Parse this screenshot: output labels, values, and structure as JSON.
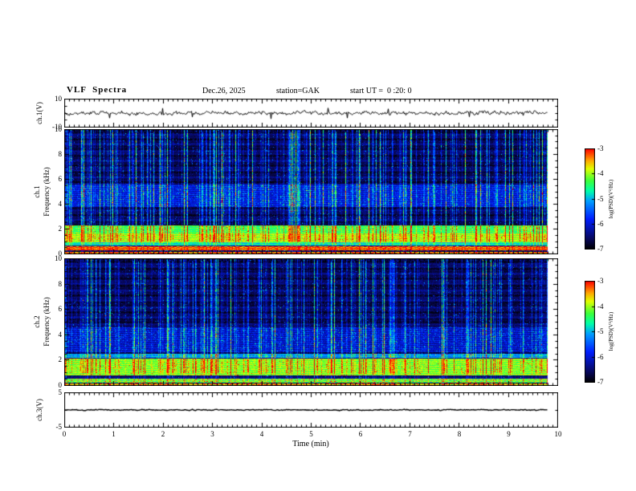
{
  "header": {
    "title": "VLF  Spectra",
    "date": "Dec.26, 2025",
    "station": "station=GAK",
    "start_ut": "start UT =  0 :20: 0"
  },
  "x_axis": {
    "label": "Time (min)",
    "min": 0,
    "max": 10,
    "major_ticks": [
      0,
      1,
      2,
      3,
      4,
      5,
      6,
      7,
      8,
      9,
      10
    ],
    "tick_labels": [
      "0",
      "1",
      "2",
      "3",
      "4",
      "5",
      "6",
      "7",
      "8",
      "9",
      "10"
    ],
    "minor_tick_interval": 0.1,
    "data_end_min": 9.8
  },
  "colorbar": {
    "label": "log(PSD)(V²/Hz)",
    "min": -7,
    "max": -3,
    "ticks": [
      -3,
      -4,
      -5,
      -6,
      -7
    ],
    "tick_labels": [
      "-3",
      "-4",
      "-5",
      "-6",
      "-7"
    ],
    "colormap": [
      [
        0.0,
        0,
        0,
        0
      ],
      [
        0.1,
        8,
        8,
        90
      ],
      [
        0.3,
        0,
        30,
        255
      ],
      [
        0.48,
        0,
        160,
        255
      ],
      [
        0.58,
        0,
        255,
        170
      ],
      [
        0.68,
        60,
        255,
        60
      ],
      [
        0.8,
        225,
        255,
        0
      ],
      [
        0.88,
        255,
        170,
        0
      ],
      [
        1.0,
        255,
        0,
        0
      ]
    ]
  },
  "chart_data": [
    {
      "type": "line",
      "name": "ch.1 voltage waveform",
      "ylabel": "ch.1(V)",
      "xlabel": "Time (min)",
      "xlim": [
        0,
        9.8
      ],
      "ylim": [
        -10,
        10
      ],
      "ytick_major": [
        10,
        -10
      ],
      "ytick_labels": [
        "10",
        "-10"
      ],
      "ytick_minor": [
        5,
        0,
        -5
      ],
      "mean_v": 0,
      "noise_amplitude_v": 1.5,
      "spike_amplitude_v": 5,
      "spike_probability": 0.012,
      "description": "Noisy broadband voltage trace centred on 0 V with sporadic impulsive spikes up to about ±5 V"
    },
    {
      "type": "heatmap",
      "name": "ch.1 VLF spectrogram",
      "ylabel_channel": "ch.1",
      "ylabel_axis": "Frequency (kHz)",
      "xlabel": "Time (min)",
      "xlim": [
        0,
        9.8
      ],
      "ylim": [
        0,
        10
      ],
      "ytick_major": [
        10,
        8,
        6,
        4,
        2,
        0
      ],
      "ytick_labels": [
        "10",
        "8",
        "6",
        "4",
        "2",
        "0"
      ],
      "value_range": [
        -7,
        -3
      ],
      "background_level": -6.8,
      "bands": [
        {
          "f_low": 0.05,
          "f_high": 0.18,
          "level": -3.4,
          "note": "thin red-orange dotted line near 0.1 kHz"
        },
        {
          "f_low": 0.3,
          "f_high": 0.6,
          "level": -3.3,
          "note": "bright red-yellow band ~0.5 kHz"
        },
        {
          "f_low": 0.65,
          "f_high": 0.95,
          "level": -4.8,
          "note": "cyan-green band"
        },
        {
          "f_low": 0.95,
          "f_high": 1.65,
          "level": -4.0,
          "note": "green-yellow band"
        },
        {
          "f_low": 1.65,
          "f_high": 2.3,
          "level": -4.4,
          "note": "green band"
        },
        {
          "f_low": 3.8,
          "f_high": 5.6,
          "level": -6.0,
          "note": "broad blue enhancement 4-5.5 kHz"
        }
      ],
      "streak_density": 0.42,
      "streak_max_boost": 2.8,
      "description": "Dense vertical sferic/interference streaks over dark background; strongest power below ~2.3 kHz"
    },
    {
      "type": "heatmap",
      "name": "ch.2 VLF spectrogram",
      "ylabel_channel": "ch.2",
      "ylabel_axis": "Frequency (kHz)",
      "xlabel": "Time (min)",
      "xlim": [
        0,
        9.8
      ],
      "ylim": [
        0,
        10
      ],
      "ytick_major": [
        10,
        8,
        6,
        4,
        2,
        0
      ],
      "ytick_labels": [
        "10",
        "8",
        "6",
        "4",
        "2",
        "0"
      ],
      "value_range": [
        -7,
        -3
      ],
      "background_level": -6.8,
      "bands": [
        {
          "f_low": 0.05,
          "f_high": 0.18,
          "level": -3.6,
          "note": "thin orange dotted line near 0.1 kHz"
        },
        {
          "f_low": 0.25,
          "f_high": 0.55,
          "level": -4.2,
          "note": "green band"
        },
        {
          "f_low": 0.8,
          "f_high": 2.1,
          "level": -4.1,
          "note": "broad green band 1-2 kHz"
        },
        {
          "f_low": 2.2,
          "f_high": 2.5,
          "level": -5.2,
          "note": "weak cyan line"
        },
        {
          "f_low": 2.6,
          "f_high": 4.6,
          "level": -6.1,
          "note": "broad blue enhancement"
        }
      ],
      "streak_density": 0.38,
      "streak_max_boost": 2.6,
      "description": "Vertical streak activity similar to ch.1; strongest power 1-2 kHz"
    },
    {
      "type": "line",
      "name": "ch.3 voltage waveform",
      "ylabel": "ch.3(V)",
      "xlabel": "Time (min)",
      "xlim": [
        0,
        9.8
      ],
      "ylim": [
        -5,
        5
      ],
      "ytick_major": [
        5,
        -5
      ],
      "ytick_labels": [
        "5",
        "-5"
      ],
      "ytick_minor": [
        0
      ],
      "mean_v": 0,
      "noise_amplitude_v": 0.15,
      "spike_amplitude_v": 0,
      "spike_probability": 0,
      "description": "Essentially flat trace at 0 V for the whole interval"
    }
  ]
}
